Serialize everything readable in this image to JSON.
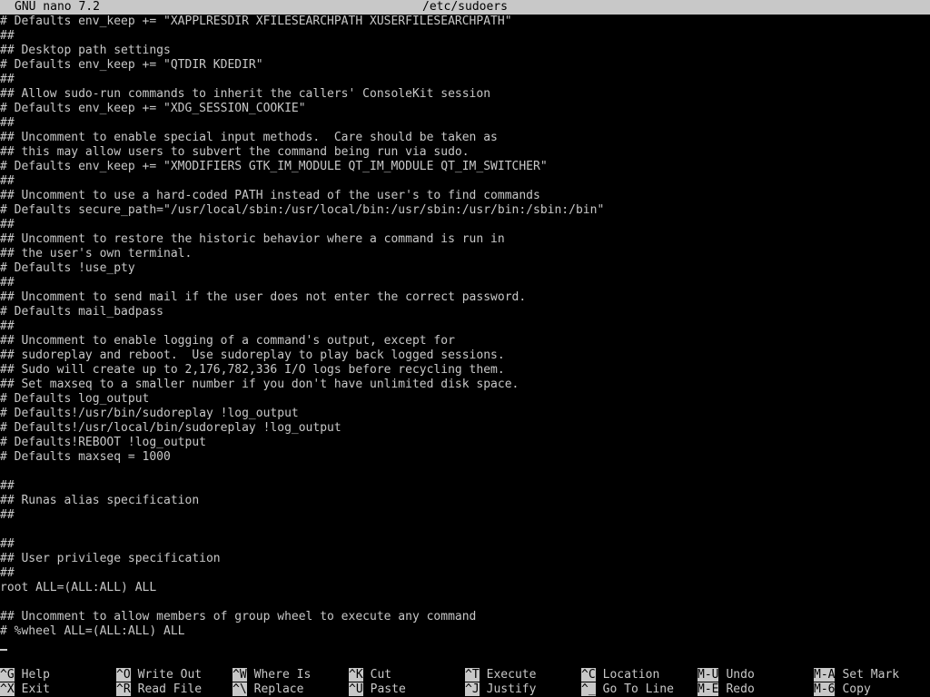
{
  "titlebar": {
    "app": "GNU nano 7.2",
    "file": "/etc/sudoers"
  },
  "editor": {
    "lines": [
      "# Defaults env_keep += \"XAPPLRESDIR XFILESEARCHPATH XUSERFILESEARCHPATH\"",
      "##",
      "## Desktop path settings",
      "# Defaults env_keep += \"QTDIR KDEDIR\"",
      "##",
      "## Allow sudo-run commands to inherit the callers' ConsoleKit session",
      "# Defaults env_keep += \"XDG_SESSION_COOKIE\"",
      "##",
      "## Uncomment to enable special input methods.  Care should be taken as",
      "## this may allow users to subvert the command being run via sudo.",
      "# Defaults env_keep += \"XMODIFIERS GTK_IM_MODULE QT_IM_MODULE QT_IM_SWITCHER\"",
      "##",
      "## Uncomment to use a hard-coded PATH instead of the user's to find commands",
      "# Defaults secure_path=\"/usr/local/sbin:/usr/local/bin:/usr/sbin:/usr/bin:/sbin:/bin\"",
      "##",
      "## Uncomment to restore the historic behavior where a command is run in",
      "## the user's own terminal.",
      "# Defaults !use_pty",
      "##",
      "## Uncomment to send mail if the user does not enter the correct password.",
      "# Defaults mail_badpass",
      "##",
      "## Uncomment to enable logging of a command's output, except for",
      "## sudoreplay and reboot.  Use sudoreplay to play back logged sessions.",
      "## Sudo will create up to 2,176,782,336 I/O logs before recycling them.",
      "## Set maxseq to a smaller number if you don't have unlimited disk space.",
      "# Defaults log_output",
      "# Defaults!/usr/bin/sudoreplay !log_output",
      "# Defaults!/usr/local/bin/sudoreplay !log_output",
      "# Defaults!REBOOT !log_output",
      "# Defaults maxseq = 1000",
      "",
      "##",
      "## Runas alias specification",
      "##",
      "",
      "##",
      "## User privilege specification",
      "##",
      "root ALL=(ALL:ALL) ALL",
      "",
      "## Uncomment to allow members of group wheel to execute any command",
      "# %wheel ALL=(ALL:ALL) ALL"
    ]
  },
  "shortcuts": {
    "row1": [
      {
        "key": "^G",
        "label": "Help"
      },
      {
        "key": "^O",
        "label": "Write Out"
      },
      {
        "key": "^W",
        "label": "Where Is"
      },
      {
        "key": "^K",
        "label": "Cut"
      },
      {
        "key": "^T",
        "label": "Execute"
      },
      {
        "key": "^C",
        "label": "Location"
      },
      {
        "key": "M-U",
        "label": "Undo"
      },
      {
        "key": "M-A",
        "label": "Set Mark"
      }
    ],
    "row2": [
      {
        "key": "^X",
        "label": "Exit"
      },
      {
        "key": "^R",
        "label": "Read File"
      },
      {
        "key": "^\\",
        "label": "Replace"
      },
      {
        "key": "^U",
        "label": "Paste"
      },
      {
        "key": "^J",
        "label": "Justify"
      },
      {
        "key": "^_",
        "label": "Go To Line"
      },
      {
        "key": "M-E",
        "label": "Redo"
      },
      {
        "key": "M-6",
        "label": "Copy"
      }
    ]
  }
}
